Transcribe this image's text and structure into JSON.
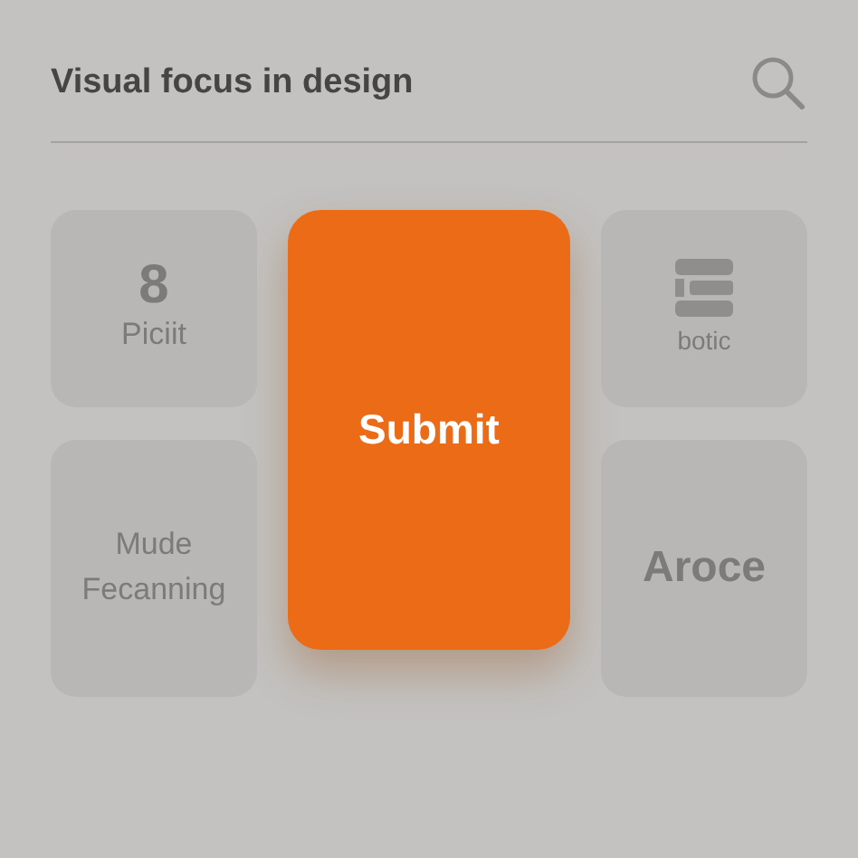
{
  "header": {
    "title": "Visual focus in design"
  },
  "tiles": [
    {
      "kind": "number",
      "value": "8",
      "label": "Piciit"
    },
    {
      "kind": "icon",
      "label": "botic"
    },
    {
      "kind": "text",
      "label": "Mude Fecanning"
    },
    {
      "kind": "big",
      "label": "Aroce"
    }
  ],
  "primary_button": {
    "label": "Submit"
  }
}
